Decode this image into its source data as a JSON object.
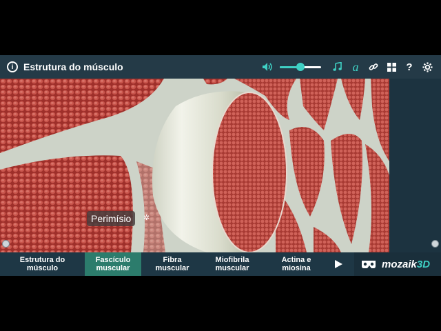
{
  "header": {
    "info_icon": "info-icon",
    "title": "Estrutura do músculo",
    "volume_level": 0.5,
    "accent_color": "#3fd0c4"
  },
  "scene": {
    "label": "Perimísio"
  },
  "tabs": [
    {
      "label": "Estrutura do músculo",
      "active": false
    },
    {
      "label": "Fascículo muscular",
      "active": true
    },
    {
      "label": "Fibra muscular",
      "active": false
    },
    {
      "label": "Miofibrila muscular",
      "active": false
    },
    {
      "label": "Actina e miosina",
      "active": false
    }
  ],
  "brand": {
    "name": "mozaik",
    "suffix": "3D"
  }
}
